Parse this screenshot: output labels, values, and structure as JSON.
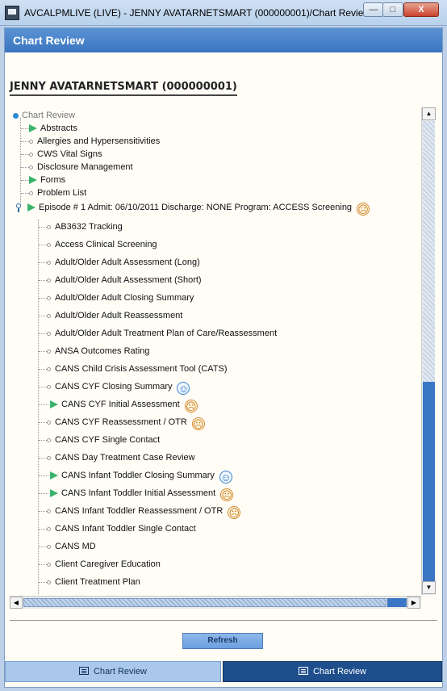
{
  "window": {
    "title": "AVCALPMLIVE (LIVE) - JENNY AVATARNETSMART (000000001)/Chart Review",
    "minimize_label": "—",
    "maximize_label": "□",
    "close_label": "X"
  },
  "panel": {
    "header": "Chart Review",
    "patient": "JENNY AVATARNETSMART (000000001)"
  },
  "tree": {
    "root": "Chart Review",
    "top_items": [
      {
        "label": "Abstracts",
        "expandable": true
      },
      {
        "label": "Allergies and Hypersensitivities",
        "expandable": false
      },
      {
        "label": "CWS Vital Signs",
        "expandable": false
      },
      {
        "label": "Disclosure Management",
        "expandable": false
      },
      {
        "label": "Forms",
        "expandable": true
      },
      {
        "label": "Problem List",
        "expandable": false
      }
    ],
    "episode": {
      "label": "Episode # 1 Admit: 06/10/2011 Discharge: NONE Program: ACCESS Screening",
      "status": "sad"
    },
    "episode_items": [
      {
        "label": "AB3632 Tracking",
        "expandable": false,
        "status": ""
      },
      {
        "label": "Access Clinical Screening",
        "expandable": false,
        "status": ""
      },
      {
        "label": "Adult/Older Adult Assessment (Long)",
        "expandable": false,
        "status": ""
      },
      {
        "label": "Adult/Older Adult Assessment (Short)",
        "expandable": false,
        "status": ""
      },
      {
        "label": "Adult/Older Adult Closing Summary",
        "expandable": false,
        "status": ""
      },
      {
        "label": "Adult/Older Adult Reassessment",
        "expandable": false,
        "status": ""
      },
      {
        "label": "Adult/Older Adult Treatment Plan of Care/Reassessment",
        "expandable": false,
        "status": ""
      },
      {
        "label": "ANSA Outcomes Rating",
        "expandable": false,
        "status": ""
      },
      {
        "label": "CANS Child Crisis Assessment Tool (CATS)",
        "expandable": false,
        "status": ""
      },
      {
        "label": "CANS CYF Closing Summary",
        "expandable": false,
        "status": "happy"
      },
      {
        "label": "CANS CYF Initial Assessment",
        "expandable": true,
        "status": "sad"
      },
      {
        "label": "CANS CYF Reassessment / OTR",
        "expandable": false,
        "status": "sad"
      },
      {
        "label": "CANS CYF Single Contact",
        "expandable": false,
        "status": ""
      },
      {
        "label": "CANS Day Treatment Case Review",
        "expandable": false,
        "status": ""
      },
      {
        "label": "CANS Infant Toddler Closing Summary",
        "expandable": true,
        "status": "happy"
      },
      {
        "label": "CANS Infant Toddler Initial Assessment",
        "expandable": true,
        "status": "sad"
      },
      {
        "label": "CANS Infant Toddler Reassessment / OTR",
        "expandable": false,
        "status": "sad"
      },
      {
        "label": "CANS Infant Toddler Single Contact",
        "expandable": false,
        "status": ""
      },
      {
        "label": "CANS MD",
        "expandable": false,
        "status": ""
      },
      {
        "label": "Client Caregiver Education",
        "expandable": false,
        "status": ""
      },
      {
        "label": "Client Treatment Plan",
        "expandable": false,
        "status": ""
      }
    ]
  },
  "buttons": {
    "refresh": "Refresh"
  },
  "tabs": [
    {
      "label": "Chart Review",
      "active": false
    },
    {
      "label": "Chart Review",
      "active": true
    }
  ],
  "icons": {
    "sad": "sad-face-icon",
    "happy": "happy-face-icon"
  },
  "colors": {
    "header": "#3f7cc6",
    "expand_arrow": "#3bb36a",
    "sad": "#d4882a",
    "happy": "#3b83d0"
  }
}
